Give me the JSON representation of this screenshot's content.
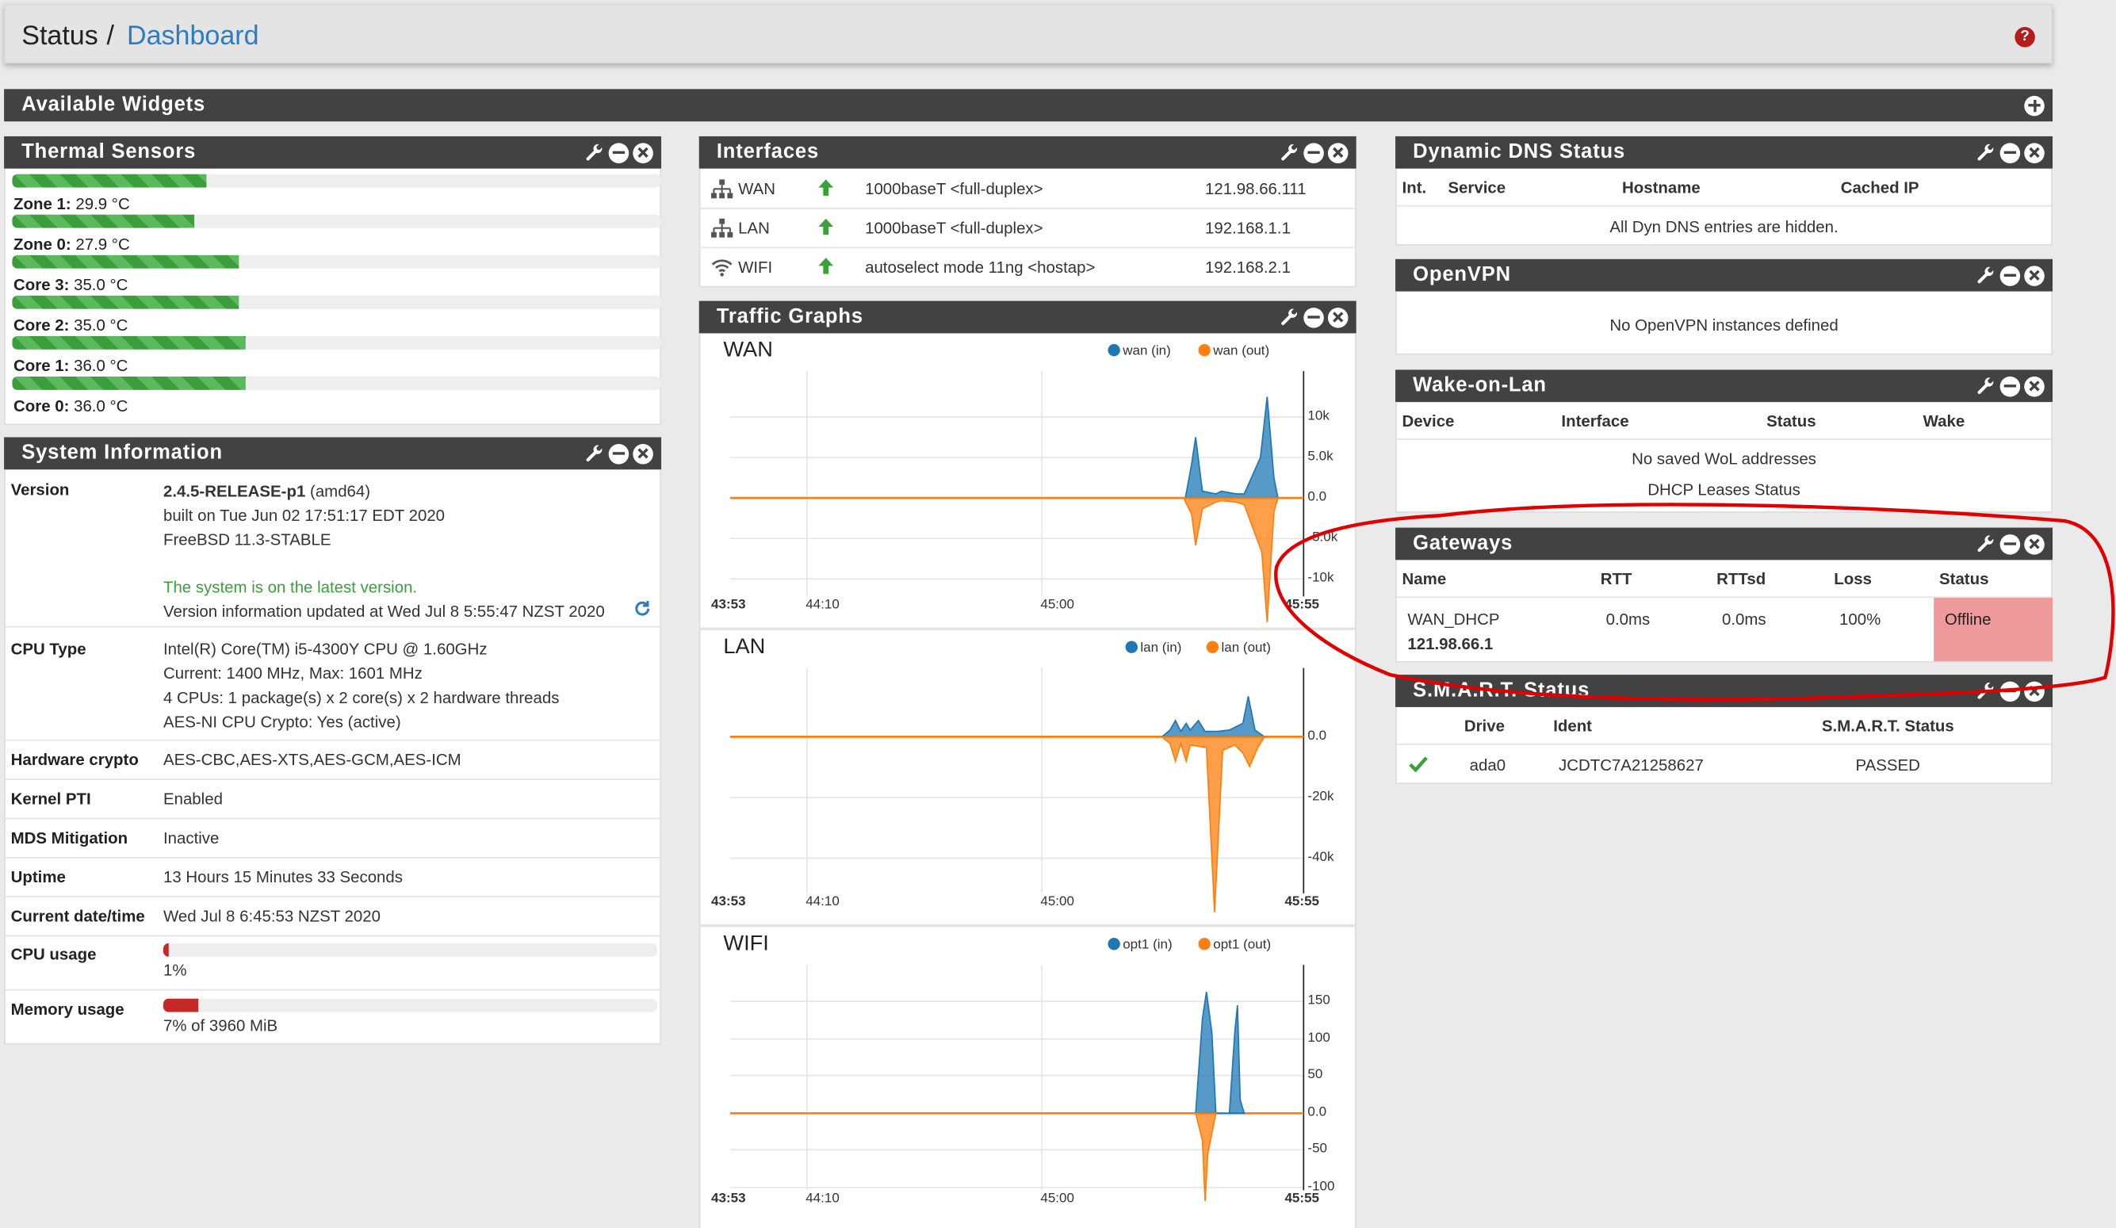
{
  "header": {
    "crumb_root": "Status",
    "crumb_sep": "/",
    "crumb_page": "Dashboard"
  },
  "available_widgets": {
    "title": "Available Widgets"
  },
  "thermal": {
    "title": "Thermal Sensors",
    "sensors": [
      {
        "name": "Zone 1:",
        "value": "29.9 °C",
        "level": 0.3
      },
      {
        "name": "Zone 0:",
        "value": "27.9 °C",
        "level": 0.28
      },
      {
        "name": "Core 3:",
        "value": "35.0 °C",
        "level": 0.35
      },
      {
        "name": "Core 2:",
        "value": "35.0 °C",
        "level": 0.35
      },
      {
        "name": "Core 1:",
        "value": "36.0 °C",
        "level": 0.36
      },
      {
        "name": "Core 0:",
        "value": "36.0 °C",
        "level": 0.36
      }
    ]
  },
  "sysinfo": {
    "title": "System Information",
    "version_label": "Version",
    "version": "2.4.5-RELEASE-p1",
    "arch": "(amd64)",
    "built": "built on Tue Jun 02 17:51:17 EDT 2020",
    "os": "FreeBSD 11.3-STABLE",
    "latest": "The system is on the latest version.",
    "updated": "Version information updated at Wed Jul 8 5:55:47 NZST 2020",
    "cpu_label": "CPU Type",
    "cpu_lines": [
      "Intel(R) Core(TM) i5-4300Y CPU @ 1.60GHz",
      "Current: 1400 MHz, Max: 1601 MHz",
      "4 CPUs: 1 package(s) x 2 core(s) x 2 hardware threads",
      "AES-NI CPU Crypto: Yes (active)"
    ],
    "crypto_label": "Hardware crypto",
    "crypto": "AES-CBC,AES-XTS,AES-GCM,AES-ICM",
    "pti_label": "Kernel PTI",
    "pti": "Enabled",
    "mds_label": "MDS Mitigation",
    "mds": "Inactive",
    "uptime_label": "Uptime",
    "uptime": "13 Hours 15 Minutes 33 Seconds",
    "date_label": "Current date/time",
    "date": "Wed Jul 8 6:45:53 NZST 2020",
    "cpu_usage_label": "CPU usage",
    "cpu_usage": "1%",
    "cpu_usage_level": 0.01,
    "mem_label": "Memory usage",
    "mem": "7% of 3960 MiB",
    "mem_level": 0.07
  },
  "interfaces": {
    "title": "Interfaces",
    "rows": [
      {
        "name": "WAN",
        "media": "1000baseT <full-duplex>",
        "ip": "121.98.66.111",
        "icon": "network-icon"
      },
      {
        "name": "LAN",
        "media": "1000baseT <full-duplex>",
        "ip": "192.168.1.1",
        "icon": "network-icon"
      },
      {
        "name": "WIFI",
        "media": "autoselect mode 11ng <hostap>",
        "ip": "192.168.2.1",
        "icon": "wifi-icon"
      }
    ]
  },
  "traffic": {
    "title": "Traffic Graphs",
    "graphs": [
      {
        "name": "WAN",
        "legend_in": "wan (in)",
        "legend_out": "wan (out)",
        "ticks": [
          "10k",
          "5.0k",
          "0.0",
          "-5.0k",
          "-10k"
        ],
        "x": [
          "43:53",
          "44:10",
          "45:00",
          "45:55"
        ]
      },
      {
        "name": "LAN",
        "legend_in": "lan (in)",
        "legend_out": "lan (out)",
        "ticks": [
          "0.0",
          "-20k",
          "-40k"
        ],
        "x": [
          "43:53",
          "44:10",
          "45:00",
          "45:55"
        ]
      },
      {
        "name": "WIFI",
        "legend_in": "opt1 (in)",
        "legend_out": "opt1 (out)",
        "ticks": [
          "150",
          "100",
          "50",
          "0.0",
          "-50",
          "-100"
        ],
        "x": [
          "43:53",
          "44:10",
          "45:00",
          "45:55"
        ]
      }
    ],
    "colors": {
      "in": "#1f77b4",
      "out": "#ff7f0e"
    }
  },
  "ddns": {
    "title": "Dynamic DNS Status",
    "cols": [
      "Int.",
      "Service",
      "Hostname",
      "Cached IP"
    ],
    "empty": "All Dyn DNS entries are hidden."
  },
  "openvpn": {
    "title": "OpenVPN",
    "empty": "No OpenVPN instances defined"
  },
  "wol": {
    "title": "Wake-on-Lan",
    "cols": [
      "Device",
      "Interface",
      "Status",
      "Wake"
    ],
    "empty": "No saved WoL addresses",
    "link": "DHCP Leases Status"
  },
  "gateways": {
    "title": "Gateways",
    "cols": [
      "Name",
      "RTT",
      "RTTsd",
      "Loss",
      "Status"
    ],
    "row": {
      "name": "WAN_DHCP",
      "ip": "121.98.66.1",
      "rtt": "0.0ms",
      "rttsd": "0.0ms",
      "loss": "100%",
      "status": "Offline"
    }
  },
  "smart": {
    "title": "S.M.A.R.T. Status",
    "cols": [
      "Drive",
      "Ident",
      "S.M.A.R.T. Status"
    ],
    "row": {
      "drive": "ada0",
      "ident": "JCDTC7A21258627",
      "status": "PASSED"
    }
  }
}
